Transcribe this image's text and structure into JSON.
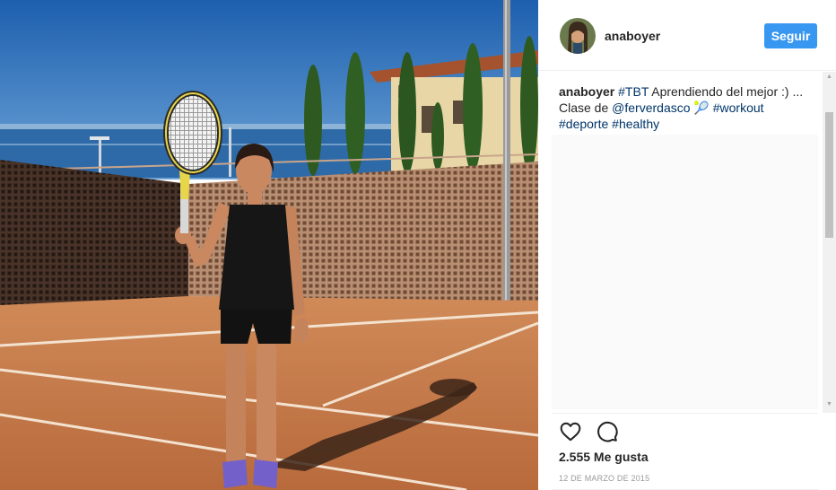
{
  "post": {
    "username": "anaboyer",
    "follow_label": "Seguir",
    "caption": {
      "username": "anaboyer",
      "parts": [
        {
          "text": "#TBT",
          "tag": true
        },
        {
          "text": " Aprendiendo del mejor :) ... Clase de ",
          "tag": false
        },
        {
          "text": "@ferverdasco",
          "tag": true
        },
        {
          "text": " 🎾 ",
          "tag": false
        },
        {
          "text": "#workout",
          "tag": true
        },
        {
          "text": " ",
          "tag": false
        },
        {
          "text": "#deporte",
          "tag": true
        },
        {
          "text": " ",
          "tag": false
        },
        {
          "text": "#healthy",
          "tag": true
        }
      ]
    },
    "likes": "2.555 Me gusta",
    "date": "12 DE MARZO DE 2015"
  },
  "icons": {
    "like": "heart-icon",
    "comment": "comment-bubble-icon",
    "scroll_up": "scroll-up-arrow-icon",
    "scroll_down": "scroll-down-arrow-icon"
  },
  "colors": {
    "follow_button": "#3897f0",
    "hashtag": "#003569",
    "text": "#262626",
    "muted": "#999999"
  }
}
